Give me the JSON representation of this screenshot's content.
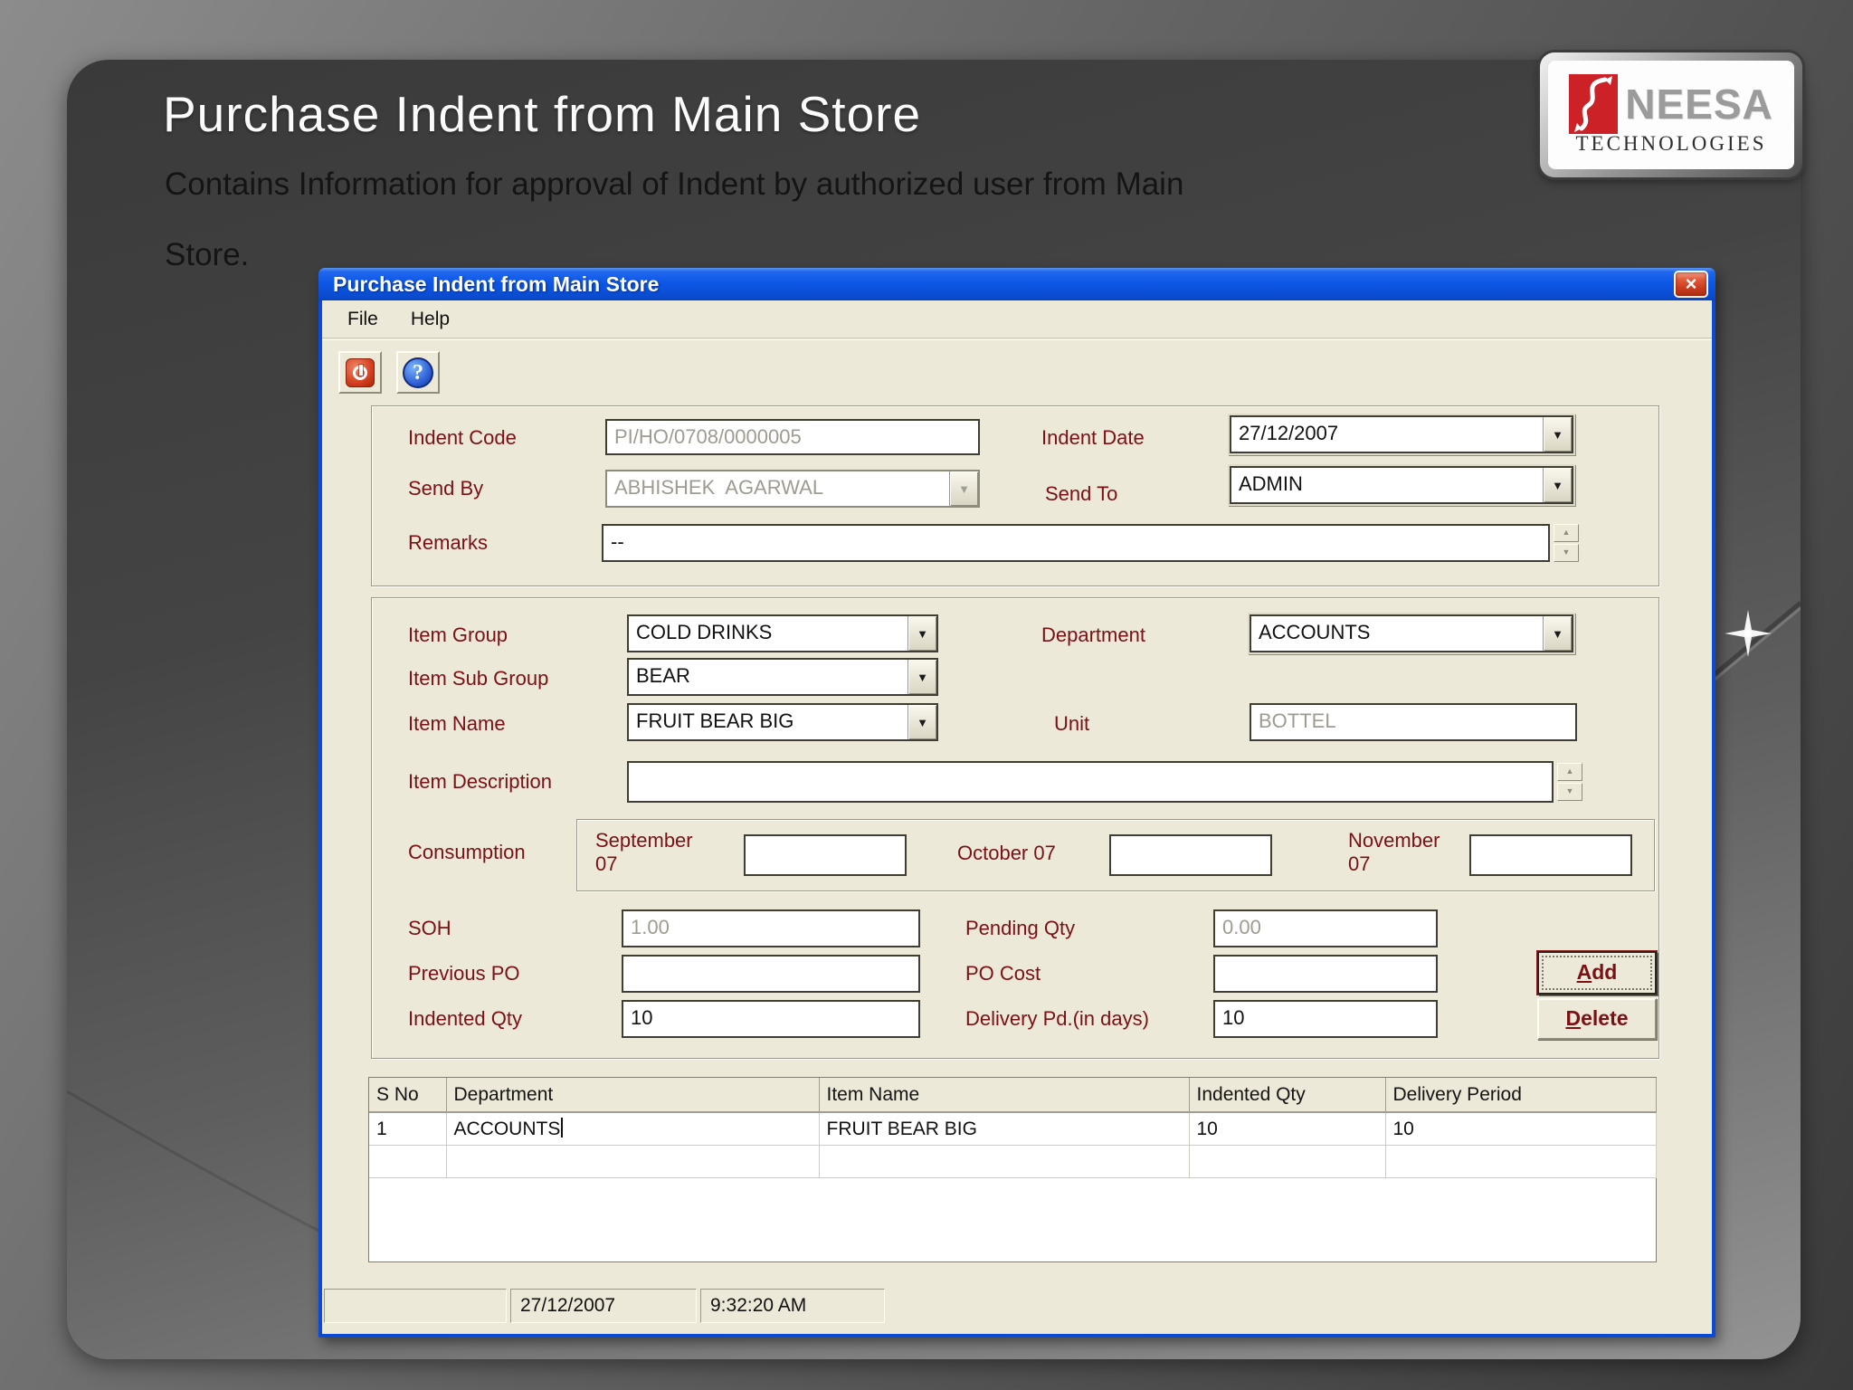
{
  "colors": {
    "titlebar_blue": "#0d57e6",
    "window_border_blue": "#0b4ad6",
    "dialog_face": "#ece9d8",
    "label_maroon": "#7b1015",
    "logo_red": "#cc2127",
    "slide_bg_dark": "#3a3a3a",
    "slide_bg_light": "#939393"
  },
  "slide": {
    "title": "Purchase Indent from Main Store",
    "subtitle_line1": "Contains Information for approval of Indent by authorized user from Main",
    "subtitle_line2": "Store.",
    "logo_name": "NEESA",
    "logo_sub": "TECHNOLOGIES"
  },
  "window": {
    "title": "Purchase Indent from Main Store",
    "menu": {
      "file": "File",
      "help": "Help"
    },
    "icons": {
      "close": "×",
      "dropdown": "▼",
      "spin_up": "▲",
      "spin_down": "▼",
      "help": "?"
    },
    "header_fields": {
      "indent_code": {
        "label": "Indent Code",
        "value": "PI/HO/0708/0000005"
      },
      "indent_date": {
        "label": "Indent Date",
        "value": "27/12/2007"
      },
      "send_by": {
        "label": "Send By",
        "value": "ABHISHEK  AGARWAL"
      },
      "send_to": {
        "label": "Send To",
        "value": "ADMIN"
      },
      "remarks": {
        "label": "Remarks",
        "value": "--"
      }
    },
    "item_fields": {
      "item_group": {
        "label": "Item Group",
        "value": "COLD DRINKS"
      },
      "department": {
        "label": "Department",
        "value": "ACCOUNTS"
      },
      "item_sub_group": {
        "label": "Item Sub Group",
        "value": "BEAR"
      },
      "item_name": {
        "label": "Item Name",
        "value": "FRUIT BEAR BIG"
      },
      "unit": {
        "label": "Unit",
        "value": "BOTTEL"
      },
      "item_description": {
        "label": "Item Description",
        "value": ""
      }
    },
    "consumption": {
      "label": "Consumption",
      "months": [
        {
          "label": "September 07",
          "value": ""
        },
        {
          "label": "October 07",
          "value": ""
        },
        {
          "label": "November 07",
          "value": ""
        }
      ]
    },
    "qty_fields": {
      "soh": {
        "label": "SOH",
        "value": "1.00"
      },
      "pending_qty": {
        "label": "Pending Qty",
        "value": "0.00"
      },
      "previous_po": {
        "label": "Previous PO",
        "value": ""
      },
      "po_cost": {
        "label": "PO Cost",
        "value": ""
      },
      "indented_qty": {
        "label": "Indented Qty",
        "value": "10"
      },
      "delivery_pd": {
        "label": "Delivery Pd.(in days)",
        "value": "10"
      }
    },
    "buttons": {
      "add_initial": "A",
      "add_rest": "dd",
      "delete_initial": "D",
      "delete_rest": "elete"
    },
    "grid": {
      "columns": [
        "S No",
        "Department",
        "Item Name",
        "Indented Qty",
        "Delivery Period"
      ],
      "rows": [
        [
          "1",
          "ACCOUNTS",
          "FRUIT BEAR BIG",
          "10",
          "10"
        ]
      ]
    },
    "statusbar": {
      "date": "27/12/2007",
      "time": "9:32:20 AM"
    }
  }
}
